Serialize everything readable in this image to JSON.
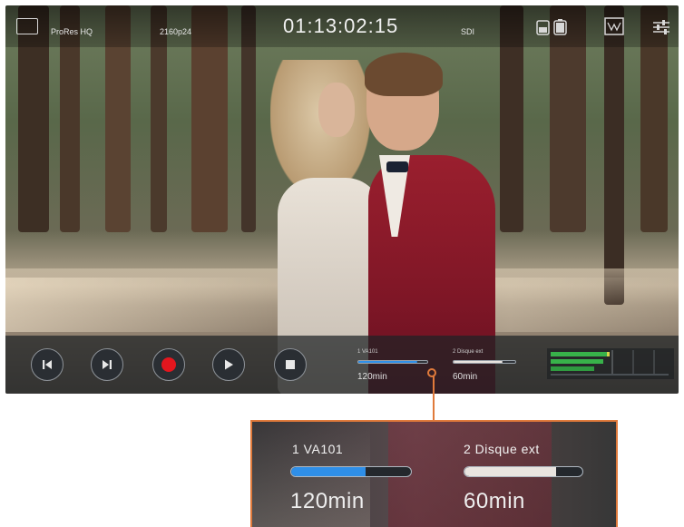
{
  "top_bar": {
    "codec": {
      "value": "ProRes HQ"
    },
    "format": {
      "value": "2160p24"
    },
    "timecode": "01:13:02:15",
    "input": {
      "value": "SDI"
    },
    "icons": [
      "display-mode-icon",
      "battery-icon",
      "scope-icon",
      "settings-sliders-icon"
    ]
  },
  "transport": {
    "buttons": [
      "skip-back",
      "skip-forward",
      "record",
      "play",
      "stop"
    ],
    "record_color": "#e4161e"
  },
  "storage_mini": {
    "slot1": {
      "label": "1 VA101",
      "time": "120min",
      "fill": 0.85
    },
    "slot2": {
      "label": "2 Disque ext",
      "time": "60min",
      "fill": 0.8
    }
  },
  "callout": {
    "accent_color": "#e07a3b",
    "slot1": {
      "label": "1  VA101",
      "time": "120min",
      "fill": 0.62,
      "color": "#2f8fe8"
    },
    "slot2": {
      "label": "2  Disque ext",
      "time": "60min",
      "fill": 0.78,
      "color": "#e9e4df"
    }
  }
}
